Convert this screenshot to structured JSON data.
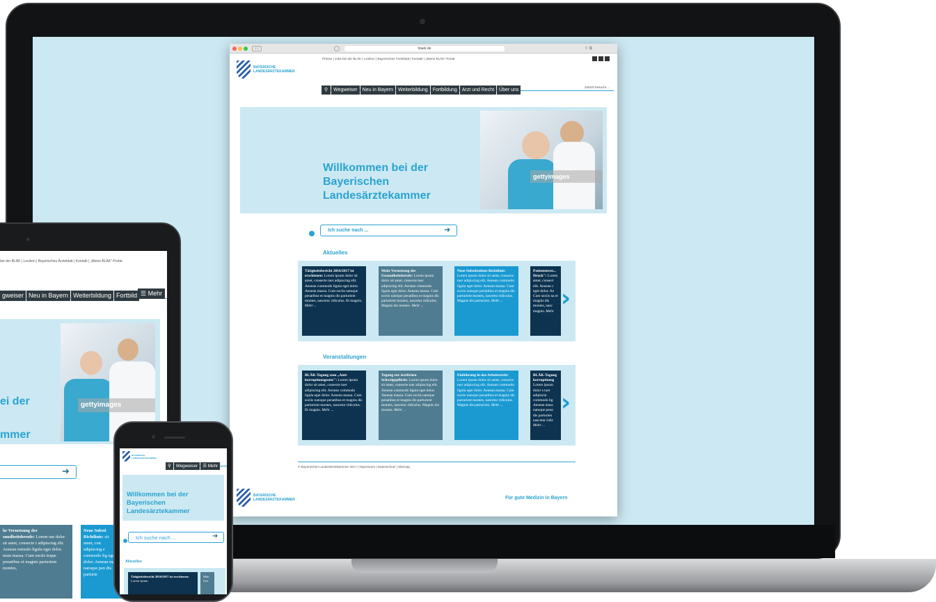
{
  "browser": {
    "url": "blaek.de",
    "top_links": "Presse | Jobs bei der BLÄK | Lexikon | Bayerisches Ärzteblatt | Kontakt | „Meine BLÄK“-Portal",
    "logo_line1": "BAYERISCHE",
    "logo_line2": "LANDESÄRZTEKAMMER",
    "nav": [
      "Wegweiser",
      "Neu in Bayern",
      "Weiterbildung",
      "Fortbildung",
      "Arzt und Recht",
      "Über uns"
    ],
    "recent": "Zuletzt besucht ...",
    "hero_title_1": "Willkommen bei der",
    "hero_title_2": "Bayerischen",
    "hero_title_3": "Landesärztekammer",
    "watermark": "gettyimages",
    "search_placeholder": "Ich suche nach ...",
    "section_news": "Aktuelles",
    "news": [
      {
        "title": "Tätigkeitsbericht 2016/2017 ist erschienen:",
        "body": "Lorem ipsum dolor sit amet, consecte tuer adipiscing elit. Aenean commodo ligula eget dolor. Aenean massa. Cum sociis natoque penatibus et magnis dis parturient montes, nascetur ridiculus. Et magnis.",
        "more": "Mehr ..."
      },
      {
        "title": "Mehr Vernetzung der Gesundheitsberufe:",
        "body": "Lorem ipsum dolor sit amet, consecte tuer adipiscing elit. Aenean commodo ligula eget dolor. Aenean massa. Cum sociis natoque penatibus et magnis dis parturient montes, nascetur ridiculus. Magnis dis montes.",
        "more": "Mehr ..."
      },
      {
        "title": "Neue Substitutions-Richtlinie:",
        "body": "Lorem ipsum dolor sit amet, consecte tuer adipiscing elit. Aenean commodo ligula eget dolor. Aenean massa. Cum sociis natoque penatibus et magnis dis parturient montes, nascetur ridiculus. Magnis dis parturient.",
        "more": "Mehr ..."
      },
      {
        "title": "Patientenver... Druck\":",
        "body": "Lorem amet, consect elit. Aenean c eget dolor. Ae Cum sociis na et magnis dis montes, nasc magnis.",
        "more": "Mehr"
      }
    ],
    "section_events": "Veranstaltungen",
    "events": [
      {
        "title": "BLÄK-Tagung zum „Anti-korruptionsgesetz\":",
        "body": "Lorem ipsum dolor sit amet, consecte tuer adipiscing elit. Aenean commodo ligula eget dolor. Aenean massa. Cum sociis natoque penatibus et magnis dis parturient montes, nascetur ridiculus. Et magnis.",
        "more": "Mehr ..."
      },
      {
        "title": "Tagung zur ärztlichen Schweigepflicht:",
        "body": "Lorem ipsum dolor sit amet, consecte tuer adipiscing elit. Aenean commodo ligula eget dolor. Aenean massa. Cum sociis natoque penatibus et magnis dis parturient montes, nascetur ridiculus. Magnis dis montes.",
        "more": "Mehr ..."
      },
      {
        "title": "Einführung in das Arbeitsrecht:",
        "body": "Lorem ipsum dolor sit amet, consecte tuer adipiscing elit. Aenean commodo ligula eget dolor. Aenean massa. Cum sociis natoque penatibus et magnis dis parturient montes, nascetur ridiculus. Magnis dis parturient.",
        "more": "Mehr ..."
      },
      {
        "title": "BLÄK-Tagung korruptionsg",
        "body": "Lorem ipsum dolor s tuer adipiscin commodo lig Aenean mass natoque pena dis parturien nascetur ridic",
        "more": "Mehr ..."
      }
    ],
    "footer_links": "© Bayerischen Landesärztekammer 2017 | Impressum | Datenschutz | Sitemap",
    "slogan": "Für gute Medizin in Bayern"
  },
  "tablet": {
    "top_links": "bei der BLÄK | Lexikon | Bayerisches Ärzteblatt | Kontakt | „Meine BLÄK“-Portal",
    "nav": [
      "gweiser",
      "Neu in Bayern",
      "Weiterbildung",
      "Fortbild"
    ],
    "more_label": "Mehr",
    "hero_1": "ei der",
    "hero_2": "mmer",
    "watermark": "gettyimages",
    "card1_title": "hr Vernetzung der sundheitsberufe:",
    "card1_body": "Lorem um dolor sit amet, consecte r adipiscing elit. Aenean mmodo ligula eget dolor. nean massa. Cum sociis toque penatibus et magnis parturient montes,",
    "card2_title": "Neue Substi Richtlinie:",
    "card2_body": "sit amet, con adipiscing e commodo lig eget dolor. Aenean mas natoque pen dis parturie"
  },
  "phone": {
    "logo_line1": "BAYERISCHE",
    "logo_line2": "LANDESÄRZTEKAMMER",
    "nav": "Wegweiser",
    "more_label": "Mehr",
    "hero_1": "Willkommen bei der",
    "hero_2": "Bayerischen",
    "hero_3": "Landesärztekammer",
    "search_placeholder": "Ich suche nach ...",
    "section_news": "Aktuelles",
    "card_title": "Tätigkeitsbericht 2016/2017 ist erschienen:",
    "card_body": "Lorem ipsum",
    "card2": "Meh Ges"
  }
}
